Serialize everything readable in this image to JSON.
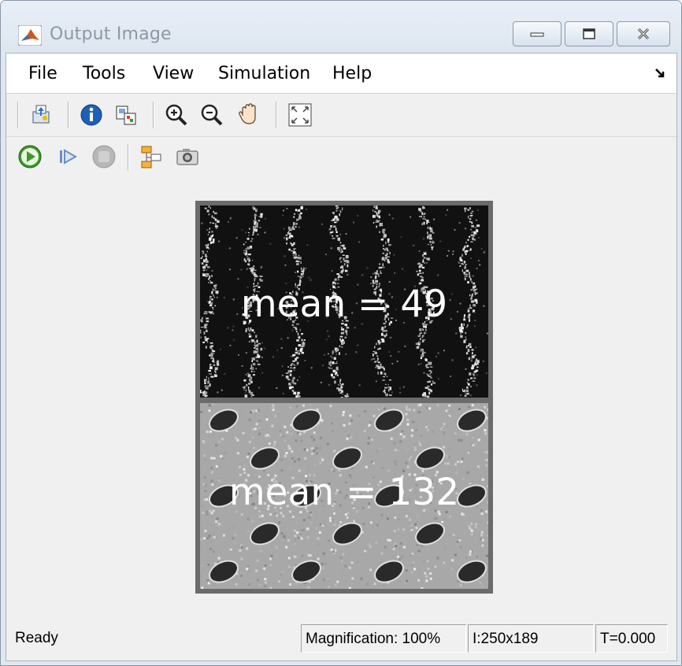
{
  "window": {
    "title": "Output Image"
  },
  "menu": [
    "File",
    "Tools",
    "View",
    "Simulation",
    "Help"
  ],
  "toolbar1": [
    "print-icon",
    "info-icon",
    "export-icon",
    "zoom-in-icon",
    "zoom-out-icon",
    "pan-hand-icon",
    "fit-to-view-icon"
  ],
  "toolbar2": [
    "run-icon",
    "step-forward-icon",
    "stop-icon",
    "highlight-block-icon",
    "snapshot-icon"
  ],
  "image": {
    "top_label": "mean = 49",
    "bottom_label": "mean = 132"
  },
  "status": {
    "state": "Ready",
    "magnification": "Magnification: 100%",
    "size": "I:250x189",
    "time": "T=0.000"
  },
  "colors": {
    "run_green": "#3d9a2a",
    "accent_blue": "#2a6fc9"
  }
}
